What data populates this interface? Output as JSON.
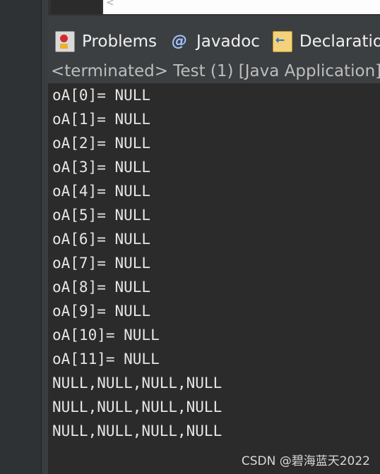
{
  "editor": {
    "scroll_arrow": "<"
  },
  "tabs": [
    {
      "label": "Problems",
      "icon": "problems-icon"
    },
    {
      "label": "Javadoc",
      "icon": "javadoc-icon",
      "icon_glyph": "@"
    },
    {
      "label": "Declaratio",
      "icon": "declaration-icon"
    }
  ],
  "console": {
    "header": "<terminated> Test (1) [Java Application]",
    "lines": [
      "oA[0]= NULL",
      "oA[1]= NULL",
      "oA[2]= NULL",
      "oA[3]= NULL",
      "oA[4]= NULL",
      "oA[5]= NULL",
      "oA[6]= NULL",
      "oA[7]= NULL",
      "oA[8]= NULL",
      "oA[9]= NULL",
      "oA[10]= NULL",
      "oA[11]= NULL",
      "NULL,NULL,NULL,NULL",
      "NULL,NULL,NULL,NULL",
      "NULL,NULL,NULL,NULL"
    ]
  },
  "watermark": "CSDN @碧海蓝天2022",
  "colors": {
    "background": "#2b2b2b",
    "panel": "#3c3f41",
    "text": "#e6e6e6",
    "header_text": "#bdbdbd"
  }
}
